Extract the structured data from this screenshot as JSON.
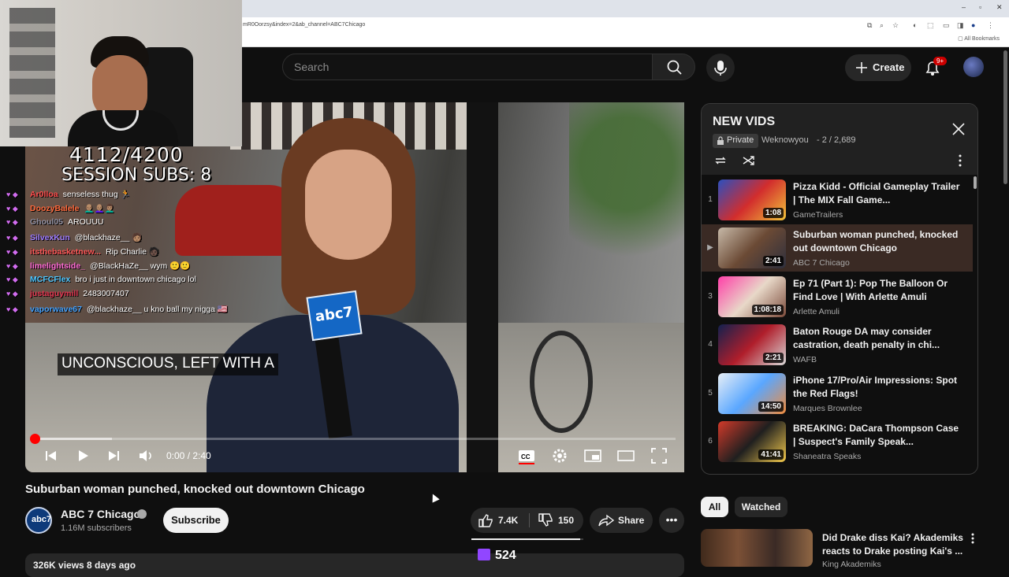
{
  "browser": {
    "url": "mR0Oorzsy&index=2&ab_channel=ABC7Chicago",
    "bookmarks_label": "All Bookmarks"
  },
  "header": {
    "search_placeholder": "Search",
    "create_label": "Create",
    "notification_badge": "9+"
  },
  "stream_overlay": {
    "sub_goal": "4112/4200",
    "session_subs": "SESSION SUBS: 8",
    "chat": [
      {
        "user": "Ar0lloa",
        "message": "senseless thug 🏃",
        "color": "#ff4d4d"
      },
      {
        "user": "DoozyBalele",
        "message": "👨🏽‍🦲👩🏽‍🦲👨🏽‍🦱",
        "color": "#ff6a3d"
      },
      {
        "user": "Ghoul05",
        "message": "AROUUU",
        "color": "#8e8ea0"
      },
      {
        "user": "SilvexKun",
        "message": "@blackhaze__ 🧑🏽",
        "color": "#9d7bff"
      },
      {
        "user": "itsthebasketnew...",
        "message": "Rip Charlie 🧑🏿",
        "color": "#ff5757"
      },
      {
        "user": "limelightside_",
        "message": "@BlackHaZe__ wym 🙂🙂",
        "color": "#ff6ad5"
      },
      {
        "user": "MCFCFlex",
        "message": "bro i just in downtown chicago lol",
        "color": "#4dc6ff"
      },
      {
        "user": "justaguymill",
        "message": "2483007407",
        "color": "#e0344f"
      },
      {
        "user": "vaporwave67",
        "message": "@blackhaze__ u kno ball my nigga 🇺🇸",
        "color": "#45a3ff"
      }
    ]
  },
  "player": {
    "caption": "UNCONSCIOUS, LEFT WITH A",
    "time": "0:00 / 2:40",
    "buffered_fraction": 0.12,
    "flag_logo_text": "abc7"
  },
  "video": {
    "title": "Suburban woman punched, knocked out downtown Chicago",
    "channel": "ABC 7 Chicago",
    "channel_avatar_text": "abc7",
    "subscribers": "1.16M subscribers",
    "subscribe_label": "Subscribe",
    "likes": "7.4K",
    "dislikes": "150",
    "like_ratio": 0.97,
    "share_label": "Share",
    "views": "326K views  8 days ago",
    "twitch_viewers": "524"
  },
  "playlist": {
    "title": "NEW VIDS",
    "privacy": "Private",
    "owner": "Weknowyou",
    "position": "2 / 2,689",
    "items": [
      {
        "index": "1",
        "title": "Pizza Kidd - Official Gameplay Trailer | The MIX Fall Game...",
        "channel": "GameTrailers",
        "duration": "1:08",
        "thumb": "linear-gradient(135deg,#2b4fbf,#d22d2d,#f2c43a)"
      },
      {
        "index": "▶",
        "title": "Suburban woman punched, knocked out downtown Chicago",
        "channel": "ABC 7 Chicago",
        "duration": "2:41",
        "thumb": "linear-gradient(135deg,#c7b9a8,#6b4a35,#2d2f3d)"
      },
      {
        "index": "3",
        "title": "Ep 71 (Part 1): Pop The Balloon Or Find Love | With Arlette Amuli",
        "channel": "Arlette Amuli",
        "duration": "1:08:18",
        "thumb": "linear-gradient(135deg,#ff3fa8,#e8d8c8,#7a4a3a)"
      },
      {
        "index": "4",
        "title": "Baton Rouge DA may consider castration, death penalty in chi...",
        "channel": "WAFB",
        "duration": "2:21",
        "thumb": "linear-gradient(135deg,#12214f,#b01e2b,#d8d8d8)"
      },
      {
        "index": "5",
        "title": "iPhone 17/Pro/Air Impressions: Spot the Red Flags!",
        "channel": "Marques Brownlee",
        "duration": "14:50",
        "thumb": "linear-gradient(135deg,#e7eef6,#5aa7ff,#f08b3c)"
      },
      {
        "index": "6",
        "title": "BREAKING: DaCara Thompson Case | Suspect's Family Speak...",
        "channel": "Shaneatra Speaks",
        "duration": "41:41",
        "thumb": "linear-gradient(135deg,#d23a2a,#1f1f1f,#f2c94c)"
      }
    ]
  },
  "filters": {
    "all": "All",
    "watched": "Watched"
  },
  "recommended": {
    "title": "Did Drake diss Kai? Akademiks reacts to Drake posting Kai's ...",
    "channel": "King Akademiks"
  }
}
